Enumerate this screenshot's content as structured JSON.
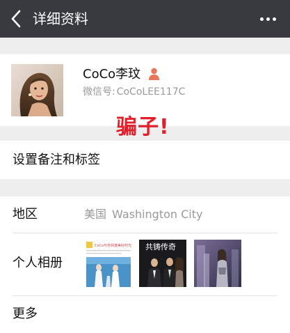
{
  "navbar": {
    "title": "详细资料",
    "back_icon": "chevron-left-icon",
    "more_icon": "more-dots-icon"
  },
  "profile": {
    "name": "CoCo李玟",
    "gender_icon": "person-icon",
    "wechat_id_label": "微信号:",
    "wechat_id_value": "CoCoLEE117C",
    "accent_color": "#e8765a"
  },
  "overlay": {
    "stamp_text": "骗子!",
    "stamp_color": "#e21f2a"
  },
  "tag_row": {
    "label": "设置备注和标签"
  },
  "info": {
    "region_label": "地区",
    "region_country": "美国",
    "region_city": "Washington City",
    "album_label": "个人相册",
    "album_thumb_1_caption": "CoCo与你共度美好时光",
    "album_thumb_2_caption": "共铸传奇",
    "more_label": "更多"
  },
  "colors": {
    "navbar_bg": "#393a3f",
    "page_bg": "#eeeeee",
    "secondary_text": "#9a9a9a"
  }
}
